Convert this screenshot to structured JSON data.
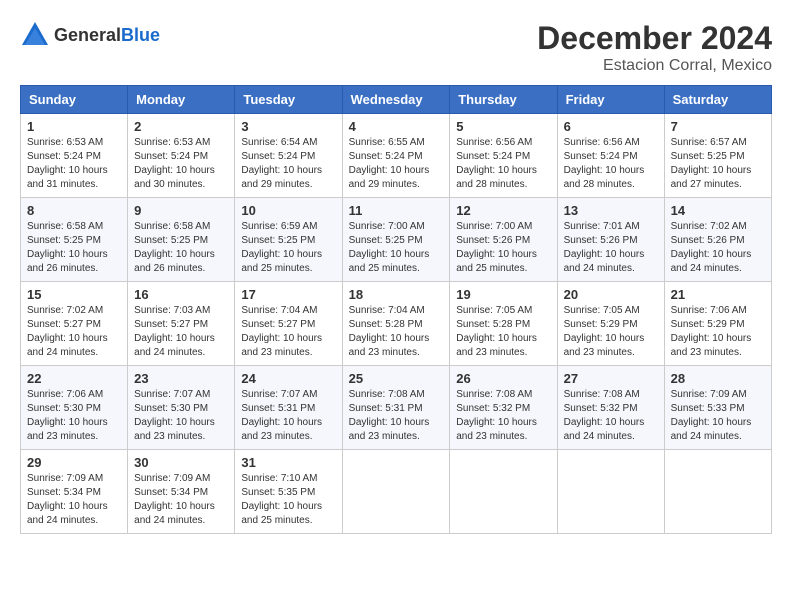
{
  "header": {
    "logo_general": "General",
    "logo_blue": "Blue",
    "month_title": "December 2024",
    "location": "Estacion Corral, Mexico"
  },
  "weekdays": [
    "Sunday",
    "Monday",
    "Tuesday",
    "Wednesday",
    "Thursday",
    "Friday",
    "Saturday"
  ],
  "weeks": [
    [
      {
        "day": "1",
        "sunrise": "6:53 AM",
        "sunset": "5:24 PM",
        "daylight": "10 hours and 31 minutes."
      },
      {
        "day": "2",
        "sunrise": "6:53 AM",
        "sunset": "5:24 PM",
        "daylight": "10 hours and 30 minutes."
      },
      {
        "day": "3",
        "sunrise": "6:54 AM",
        "sunset": "5:24 PM",
        "daylight": "10 hours and 29 minutes."
      },
      {
        "day": "4",
        "sunrise": "6:55 AM",
        "sunset": "5:24 PM",
        "daylight": "10 hours and 29 minutes."
      },
      {
        "day": "5",
        "sunrise": "6:56 AM",
        "sunset": "5:24 PM",
        "daylight": "10 hours and 28 minutes."
      },
      {
        "day": "6",
        "sunrise": "6:56 AM",
        "sunset": "5:24 PM",
        "daylight": "10 hours and 28 minutes."
      },
      {
        "day": "7",
        "sunrise": "6:57 AM",
        "sunset": "5:25 PM",
        "daylight": "10 hours and 27 minutes."
      }
    ],
    [
      {
        "day": "8",
        "sunrise": "6:58 AM",
        "sunset": "5:25 PM",
        "daylight": "10 hours and 26 minutes."
      },
      {
        "day": "9",
        "sunrise": "6:58 AM",
        "sunset": "5:25 PM",
        "daylight": "10 hours and 26 minutes."
      },
      {
        "day": "10",
        "sunrise": "6:59 AM",
        "sunset": "5:25 PM",
        "daylight": "10 hours and 25 minutes."
      },
      {
        "day": "11",
        "sunrise": "7:00 AM",
        "sunset": "5:25 PM",
        "daylight": "10 hours and 25 minutes."
      },
      {
        "day": "12",
        "sunrise": "7:00 AM",
        "sunset": "5:26 PM",
        "daylight": "10 hours and 25 minutes."
      },
      {
        "day": "13",
        "sunrise": "7:01 AM",
        "sunset": "5:26 PM",
        "daylight": "10 hours and 24 minutes."
      },
      {
        "day": "14",
        "sunrise": "7:02 AM",
        "sunset": "5:26 PM",
        "daylight": "10 hours and 24 minutes."
      }
    ],
    [
      {
        "day": "15",
        "sunrise": "7:02 AM",
        "sunset": "5:27 PM",
        "daylight": "10 hours and 24 minutes."
      },
      {
        "day": "16",
        "sunrise": "7:03 AM",
        "sunset": "5:27 PM",
        "daylight": "10 hours and 24 minutes."
      },
      {
        "day": "17",
        "sunrise": "7:04 AM",
        "sunset": "5:27 PM",
        "daylight": "10 hours and 23 minutes."
      },
      {
        "day": "18",
        "sunrise": "7:04 AM",
        "sunset": "5:28 PM",
        "daylight": "10 hours and 23 minutes."
      },
      {
        "day": "19",
        "sunrise": "7:05 AM",
        "sunset": "5:28 PM",
        "daylight": "10 hours and 23 minutes."
      },
      {
        "day": "20",
        "sunrise": "7:05 AM",
        "sunset": "5:29 PM",
        "daylight": "10 hours and 23 minutes."
      },
      {
        "day": "21",
        "sunrise": "7:06 AM",
        "sunset": "5:29 PM",
        "daylight": "10 hours and 23 minutes."
      }
    ],
    [
      {
        "day": "22",
        "sunrise": "7:06 AM",
        "sunset": "5:30 PM",
        "daylight": "10 hours and 23 minutes."
      },
      {
        "day": "23",
        "sunrise": "7:07 AM",
        "sunset": "5:30 PM",
        "daylight": "10 hours and 23 minutes."
      },
      {
        "day": "24",
        "sunrise": "7:07 AM",
        "sunset": "5:31 PM",
        "daylight": "10 hours and 23 minutes."
      },
      {
        "day": "25",
        "sunrise": "7:08 AM",
        "sunset": "5:31 PM",
        "daylight": "10 hours and 23 minutes."
      },
      {
        "day": "26",
        "sunrise": "7:08 AM",
        "sunset": "5:32 PM",
        "daylight": "10 hours and 23 minutes."
      },
      {
        "day": "27",
        "sunrise": "7:08 AM",
        "sunset": "5:32 PM",
        "daylight": "10 hours and 24 minutes."
      },
      {
        "day": "28",
        "sunrise": "7:09 AM",
        "sunset": "5:33 PM",
        "daylight": "10 hours and 24 minutes."
      }
    ],
    [
      {
        "day": "29",
        "sunrise": "7:09 AM",
        "sunset": "5:34 PM",
        "daylight": "10 hours and 24 minutes."
      },
      {
        "day": "30",
        "sunrise": "7:09 AM",
        "sunset": "5:34 PM",
        "daylight": "10 hours and 24 minutes."
      },
      {
        "day": "31",
        "sunrise": "7:10 AM",
        "sunset": "5:35 PM",
        "daylight": "10 hours and 25 minutes."
      },
      null,
      null,
      null,
      null
    ]
  ],
  "labels": {
    "sunrise": "Sunrise:",
    "sunset": "Sunset:",
    "daylight": "Daylight:"
  }
}
